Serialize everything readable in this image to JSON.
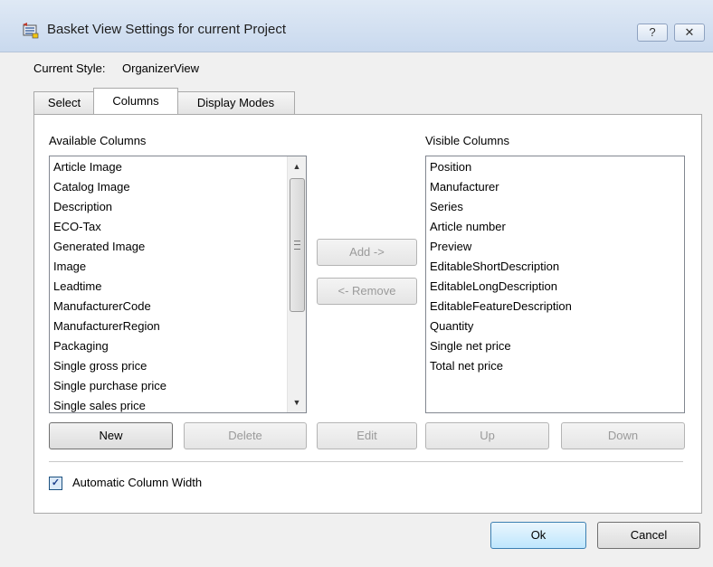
{
  "window": {
    "title": "Basket View Settings for current Project",
    "help_label": "?",
    "close_label": "✕"
  },
  "current_style": {
    "label": "Current Style:",
    "value": "OrganizerView"
  },
  "tabs": [
    {
      "label": "Select",
      "active": false
    },
    {
      "label": "Columns",
      "active": true
    },
    {
      "label": "Display Modes",
      "active": false
    }
  ],
  "available_columns": {
    "header": "Available Columns",
    "items": [
      "Article Image",
      "Catalog Image",
      "Description",
      "ECO-Tax",
      "Generated Image",
      "Image",
      "Leadtime",
      "ManufacturerCode",
      "ManufacturerRegion",
      "Packaging",
      "Single gross price",
      "Single purchase price",
      "Single sales price"
    ]
  },
  "visible_columns": {
    "header": "Visible Columns",
    "items": [
      "Position",
      "Manufacturer",
      "Series",
      "Article number",
      "Preview",
      "EditableShortDescription",
      "EditableLongDescription",
      "EditableFeatureDescription",
      "Quantity",
      "Single net price",
      "Total net price"
    ]
  },
  "buttons": {
    "add": "Add ->",
    "remove": "<- Remove",
    "new": "New",
    "delete": "Delete",
    "edit": "Edit",
    "up": "Up",
    "down": "Down",
    "ok": "Ok",
    "cancel": "Cancel"
  },
  "options": {
    "auto_width_label": "Automatic Column Width",
    "auto_width_checked": true
  },
  "icons": {
    "app": "basket-settings-icon",
    "scroll_up": "scroll-up-arrow-icon",
    "scroll_down": "scroll-down-arrow-icon",
    "check": "checkmark-icon"
  }
}
